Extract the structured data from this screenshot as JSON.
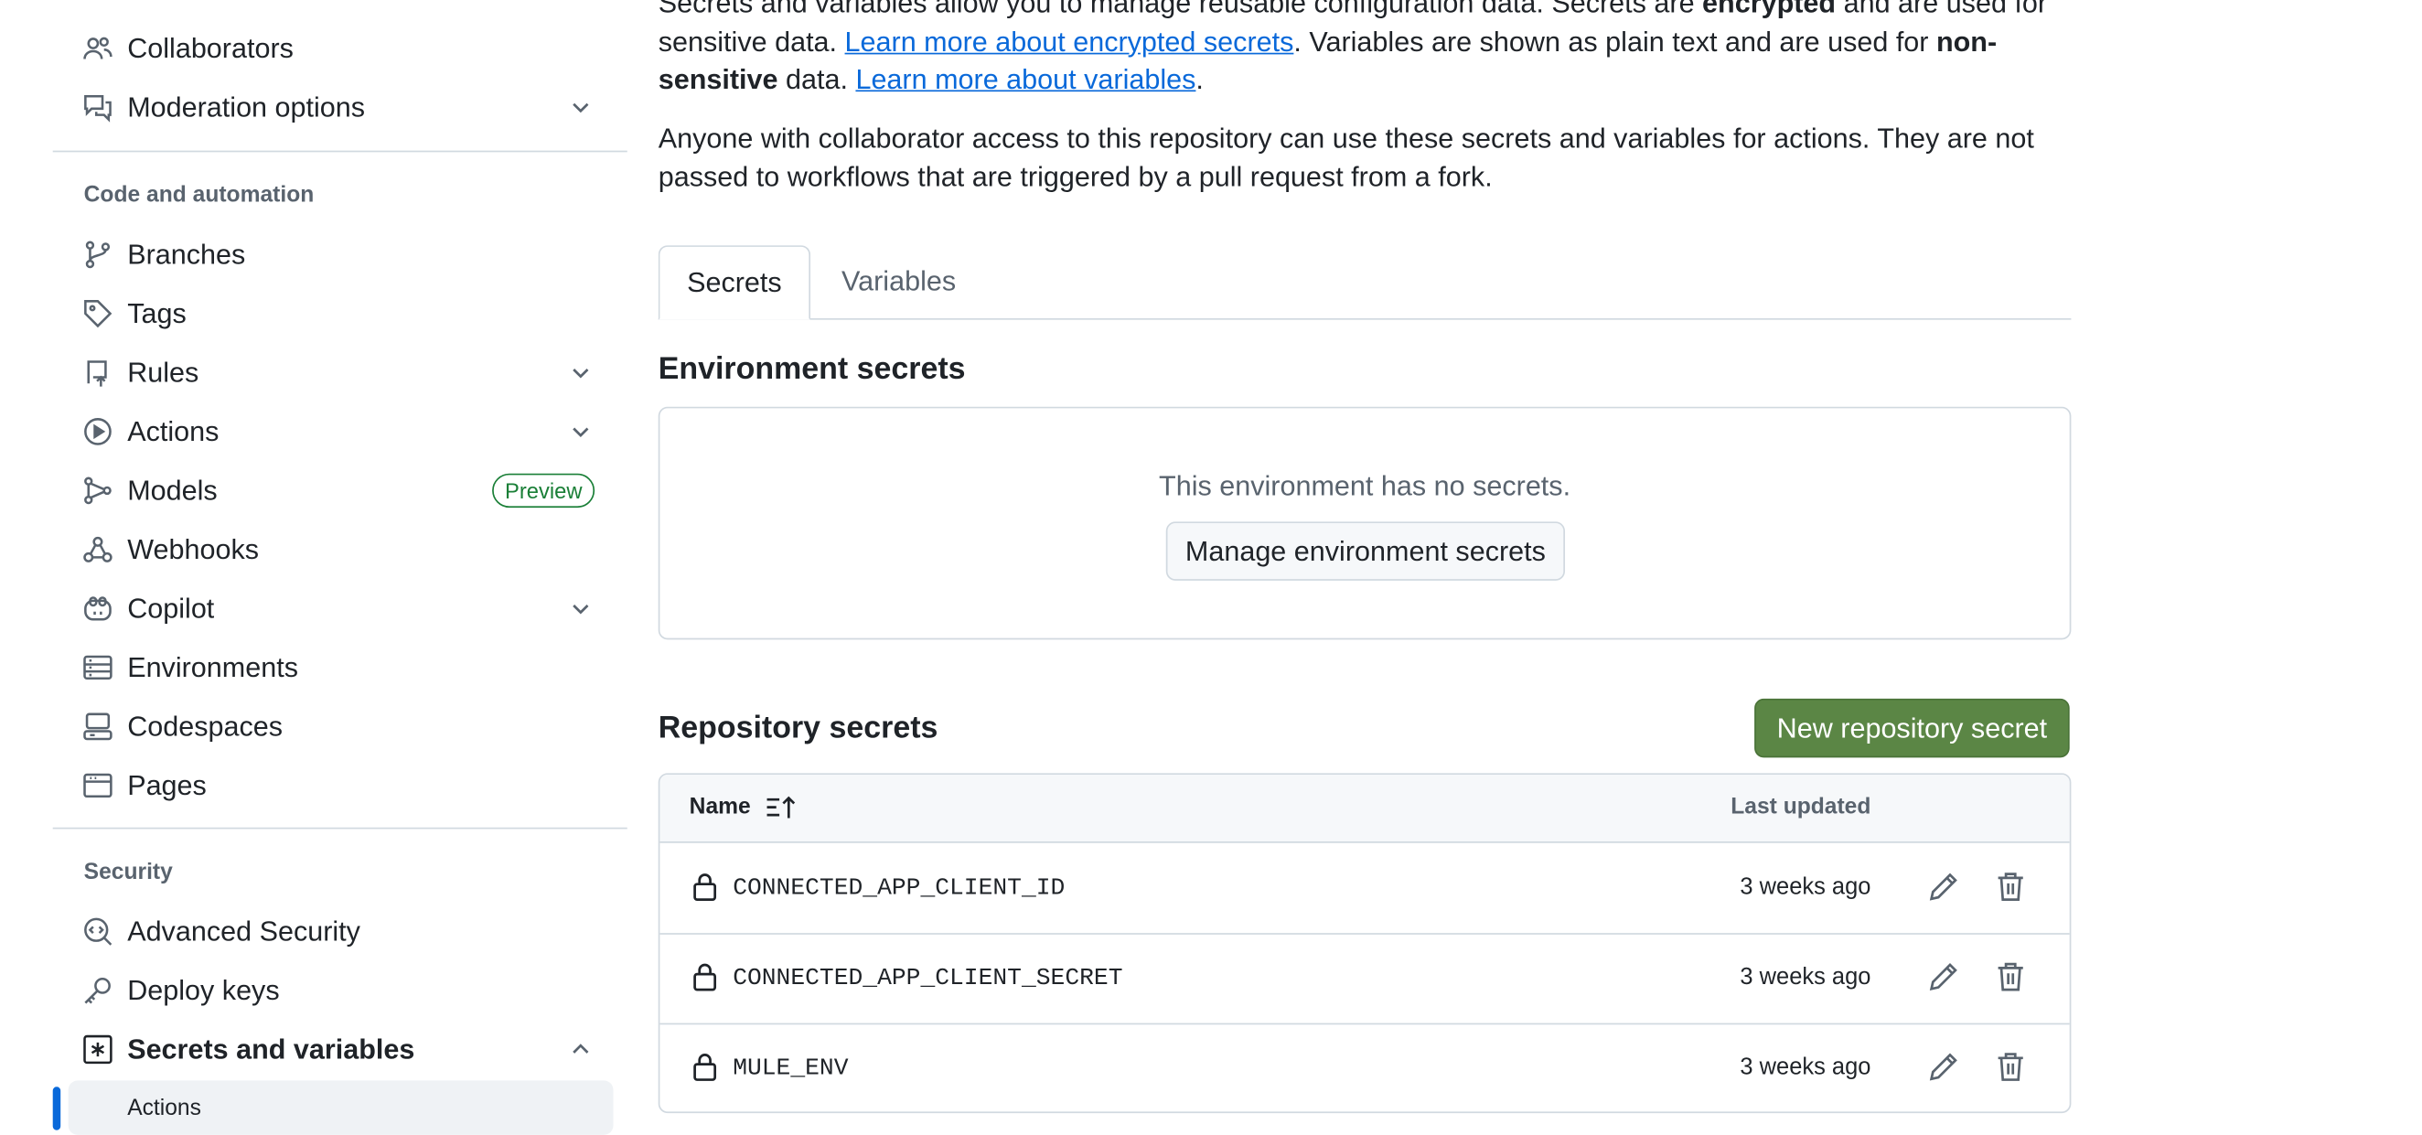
{
  "sidebar": {
    "items_top": [
      {
        "label": "Collaborators",
        "icon": "people-icon"
      },
      {
        "label": "Moderation options",
        "icon": "comment-discussion-icon",
        "expandable": true
      }
    ],
    "code_heading": "Code and automation",
    "code_items": [
      {
        "label": "Branches",
        "icon": "git-branch-icon"
      },
      {
        "label": "Tags",
        "icon": "tag-icon"
      },
      {
        "label": "Rules",
        "icon": "repo-push-icon",
        "expandable": true
      },
      {
        "label": "Actions",
        "icon": "play-icon",
        "expandable": true
      },
      {
        "label": "Models",
        "icon": "models-icon",
        "badge": "Preview"
      },
      {
        "label": "Webhooks",
        "icon": "webhook-icon"
      },
      {
        "label": "Copilot",
        "icon": "copilot-icon",
        "expandable": true
      },
      {
        "label": "Environments",
        "icon": "server-icon"
      },
      {
        "label": "Codespaces",
        "icon": "codespaces-icon"
      },
      {
        "label": "Pages",
        "icon": "browser-icon"
      }
    ],
    "security_heading": "Security",
    "security_items": [
      {
        "label": "Advanced Security",
        "icon": "codescan-icon"
      },
      {
        "label": "Deploy keys",
        "icon": "key-icon"
      },
      {
        "label": "Secrets and variables",
        "icon": "key-asterisk-icon",
        "expanded": true
      }
    ],
    "sub_items": [
      {
        "label": "Actions",
        "selected": true
      }
    ],
    "accent_color": "#0969da",
    "badge_color": "#1a7f37"
  },
  "intro": {
    "p1_a": "Secrets and variables allow you to manage reusable configuration data. Secrets are ",
    "p1_bold1": "encrypted",
    "p1_b": " and are used for sensitive data. ",
    "p1_link1": "Learn more about encrypted secrets",
    "p1_c": ". Variables are shown as plain text and are used for ",
    "p1_bold2": "non-sensitive",
    "p1_d": " data. ",
    "p1_link2": "Learn more about variables",
    "p1_e": ".",
    "p2": "Anyone with collaborator access to this repository can use these secrets and variables for actions. They are not passed to workflows that are triggered by a pull request from a fork."
  },
  "tabs": [
    {
      "label": "Secrets",
      "selected": true
    },
    {
      "label": "Variables",
      "selected": false
    }
  ],
  "environment": {
    "heading": "Environment secrets",
    "empty_text": "This environment has no secrets.",
    "manage_button": "Manage environment secrets"
  },
  "repository": {
    "heading": "Repository secrets",
    "new_button": "New repository secret",
    "primary_color": "#5b8645",
    "columns": {
      "name": "Name",
      "updated": "Last updated"
    },
    "rows": [
      {
        "name": "CONNECTED_APP_CLIENT_ID",
        "updated": "3 weeks ago"
      },
      {
        "name": "CONNECTED_APP_CLIENT_SECRET",
        "updated": "3 weeks ago"
      },
      {
        "name": "MULE_ENV",
        "updated": "3 weeks ago"
      }
    ]
  }
}
